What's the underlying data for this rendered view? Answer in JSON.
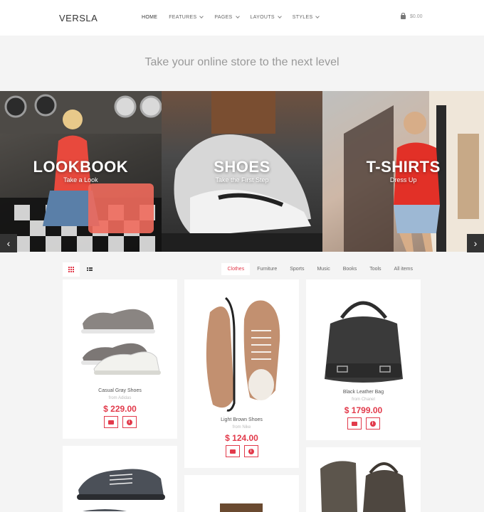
{
  "header": {
    "logo": "VERSLA",
    "nav": [
      {
        "label": "HOME",
        "active": true
      },
      {
        "label": "FEATURES"
      },
      {
        "label": "PAGES"
      },
      {
        "label": "LAYOUTS"
      },
      {
        "label": "STYLES"
      }
    ],
    "cart_total": "$0.00"
  },
  "tagline": "Take your online store to the next level",
  "slider": {
    "panels": [
      {
        "title": "LOOKBOOK",
        "subtitle": "Take a Look"
      },
      {
        "title": "SHOES",
        "subtitle": "Take the First Step"
      },
      {
        "title": "T-SHIRTS",
        "subtitle": "Dress Up"
      }
    ]
  },
  "filters": [
    "Clothes",
    "Furniture",
    "Sports",
    "Music",
    "Books",
    "Tools",
    "All items"
  ],
  "active_filter": "Clothes",
  "products": [
    {
      "name": "Casual Gray Shoes",
      "brand": "from Adidas",
      "price": "$ 229.00"
    },
    {
      "name": "Light Brown Shoes",
      "brand": "from Nike",
      "price": "$ 124.00"
    },
    {
      "name": "Black Leather Bag",
      "brand": "from Chanel",
      "price": "$ 1799.00"
    }
  ],
  "colors": {
    "accent": "#e23a4b",
    "background": "#f4f4f4"
  }
}
